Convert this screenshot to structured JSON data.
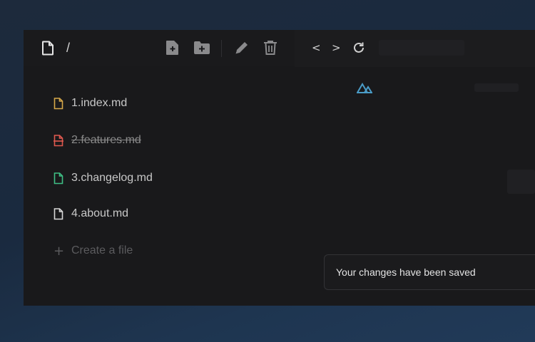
{
  "toolbar": {
    "path": "/",
    "icons": [
      "file-icon",
      "new-file-icon",
      "new-folder-icon",
      "pencil-icon",
      "trash-icon"
    ]
  },
  "preview": {
    "back": "<",
    "forward": ">",
    "icons": [
      "reload-icon",
      "nuxt-logo-icon"
    ]
  },
  "files": [
    {
      "label": "1.index.md",
      "status": "modified",
      "color": "#d6a84a"
    },
    {
      "label": "2.features.md",
      "status": "deleted",
      "color": "#e0594f"
    },
    {
      "label": "3.changelog.md",
      "status": "added",
      "color": "#3fbf85"
    },
    {
      "label": "4.about.md",
      "status": "unchanged",
      "color": "#d8d8d8"
    }
  ],
  "create_file": {
    "plus": "+",
    "label": "Create a file"
  },
  "toast": {
    "message": "Your changes have been saved"
  },
  "colors": {
    "accent_logo": "#4a9cc7",
    "window_bg": "#19191b"
  }
}
